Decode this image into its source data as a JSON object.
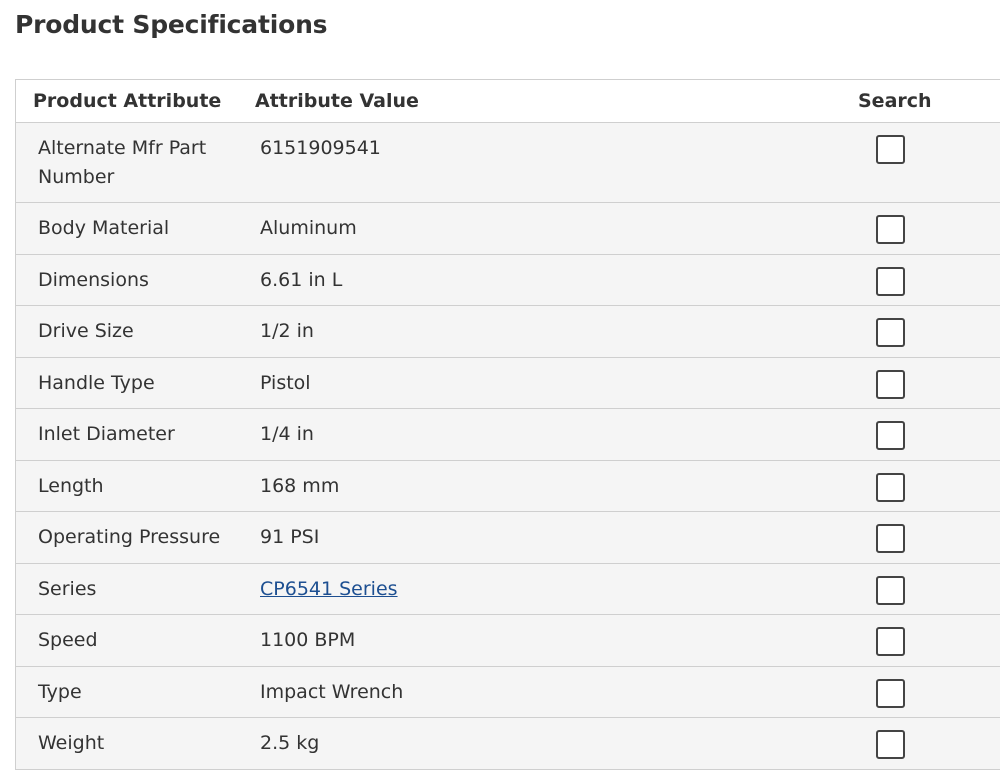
{
  "page": {
    "title": "Product Specifications"
  },
  "table": {
    "headers": {
      "attribute": "Product Attribute",
      "value": "Attribute Value",
      "search": "Search"
    },
    "rows": [
      {
        "attribute": "Alternate Mfr Part Number",
        "value": "6151909541",
        "is_link": false,
        "search_checked": false
      },
      {
        "attribute": "Body Material",
        "value": "Aluminum",
        "is_link": false,
        "search_checked": false
      },
      {
        "attribute": "Dimensions",
        "value": "6.61 in L",
        "is_link": false,
        "search_checked": false
      },
      {
        "attribute": "Drive Size",
        "value": "1/2 in",
        "is_link": false,
        "search_checked": false
      },
      {
        "attribute": "Handle Type",
        "value": "Pistol",
        "is_link": false,
        "search_checked": false
      },
      {
        "attribute": "Inlet Diameter",
        "value": "1/4 in",
        "is_link": false,
        "search_checked": false
      },
      {
        "attribute": "Length",
        "value": "168 mm",
        "is_link": false,
        "search_checked": false
      },
      {
        "attribute": "Operating Pressure",
        "value": "91 PSI",
        "is_link": false,
        "search_checked": false
      },
      {
        "attribute": "Series",
        "value": "CP6541 Series",
        "is_link": true,
        "search_checked": false
      },
      {
        "attribute": "Speed",
        "value": "1100 BPM",
        "is_link": false,
        "search_checked": false
      },
      {
        "attribute": "Type",
        "value": "Impact Wrench",
        "is_link": false,
        "search_checked": false
      },
      {
        "attribute": "Weight",
        "value": "2.5 kg",
        "is_link": false,
        "search_checked": false
      }
    ]
  },
  "colors": {
    "text": "#333333",
    "link": "#1d4f91",
    "row_background": "#f5f5f5",
    "border": "#cfcfcf"
  }
}
